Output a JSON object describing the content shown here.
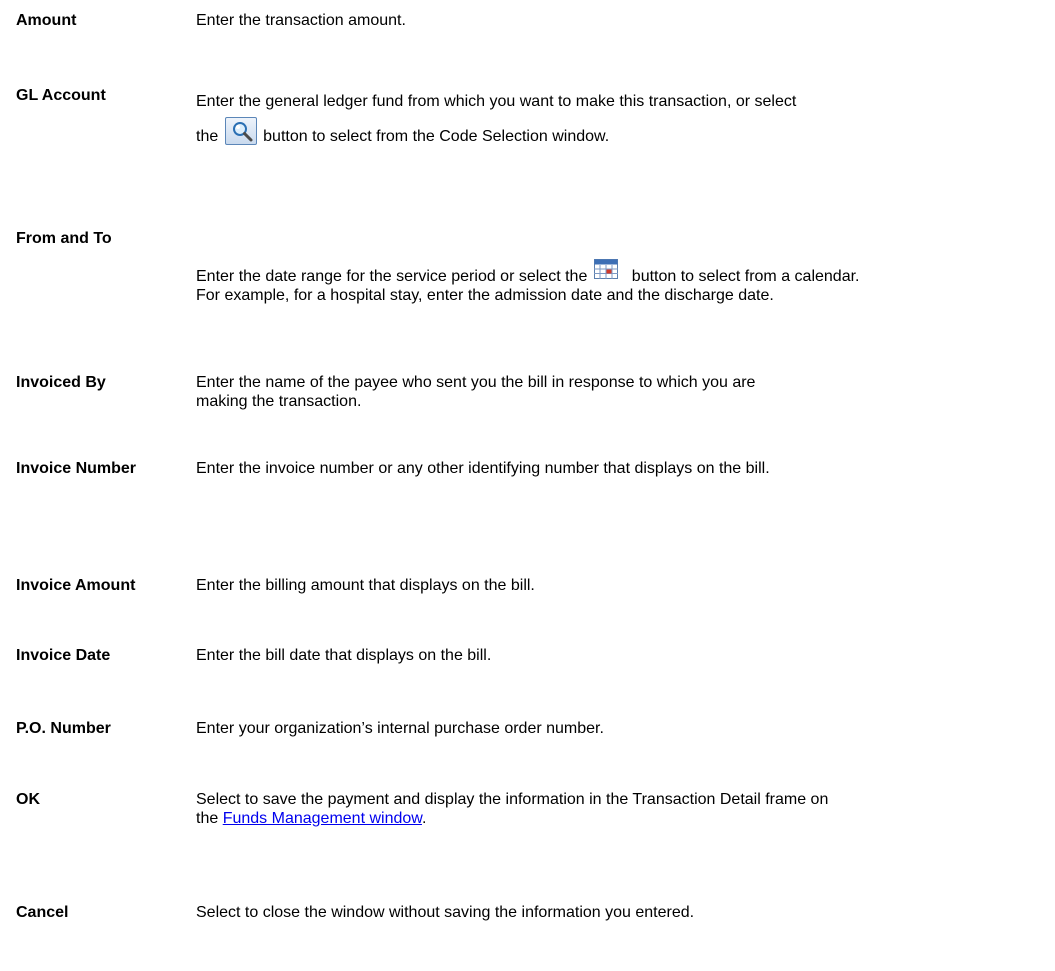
{
  "rows": [
    {
      "term": "Amount",
      "desc": "Enter the transaction amount."
    },
    {
      "term": "GL Account",
      "desc_a": "Enter the general ledger fund from which you want to make this transaction, or select the",
      "desc_b": "button to select from the Code Selection window."
    },
    {
      "term": "From and To",
      "desc_a": "Enter the date range for the service period or select the",
      "desc_b": "button to select from a calendar. For example, for a hospital stay, enter the admission date and the discharge date."
    },
    {
      "term": "Invoiced By",
      "desc": "Enter the name of the payee who sent you the bill in response to which you are making the transaction."
    },
    {
      "term": "Invoice Number",
      "desc": "Enter the invoice number or any other identifying number that displays on the bill."
    },
    {
      "term": "Invoice Amount",
      "desc": "Enter the billing amount that displays on the bill."
    },
    {
      "term": "Invoice Date",
      "desc": "Enter the bill date that displays on the bill."
    },
    {
      "term": "P.O. Number",
      "desc": "Enter your organization’s internal purchase order number."
    },
    {
      "term": "OK",
      "desc_a": "Select to save the payment and display the information in the Transaction Detail frame on the",
      "link": "Funds Management window",
      "desc_b": "."
    },
    {
      "term": "Cancel",
      "desc": "Select to close the window without saving the information you entered."
    }
  ],
  "icons": {
    "search_button": "magnifier-icon",
    "calendar_button": "calendar-icon"
  },
  "colors": {
    "link": "#0000ee",
    "button_border": "#5b86b8"
  }
}
